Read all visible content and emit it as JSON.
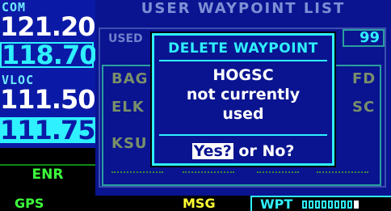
{
  "radios": {
    "com_label": "COM",
    "com_active": "121.200",
    "com_standby": "118.700",
    "vloc_label": "VLOC",
    "vloc_active": "111.50",
    "vloc_standby": "111.75",
    "cdi_mode": "ENR"
  },
  "page": {
    "title": "USER WAYPOINT LIST",
    "used_label": "USED",
    "count_partial": "99",
    "list_items_left": [
      "BAG",
      "ELK",
      "KSU"
    ],
    "list_items_right": [
      "FD",
      "SC"
    ]
  },
  "dialog": {
    "title": "DELETE WAYPOINT",
    "waypoint_name": "HOGSC",
    "message_line1": "not currently",
    "message_line2": "used",
    "yes_label": "Yes?",
    "or_no_label": "or No?"
  },
  "status_bar": {
    "nav_source": "GPS",
    "msg": "MSG",
    "page_group": "WPT",
    "page_count": 9,
    "active_page_index": 8
  },
  "colors": {
    "cyan": "#2ff0ff",
    "screen_blue": "#0a1490",
    "green": "#3cff3c",
    "yellow": "#ffff33"
  }
}
